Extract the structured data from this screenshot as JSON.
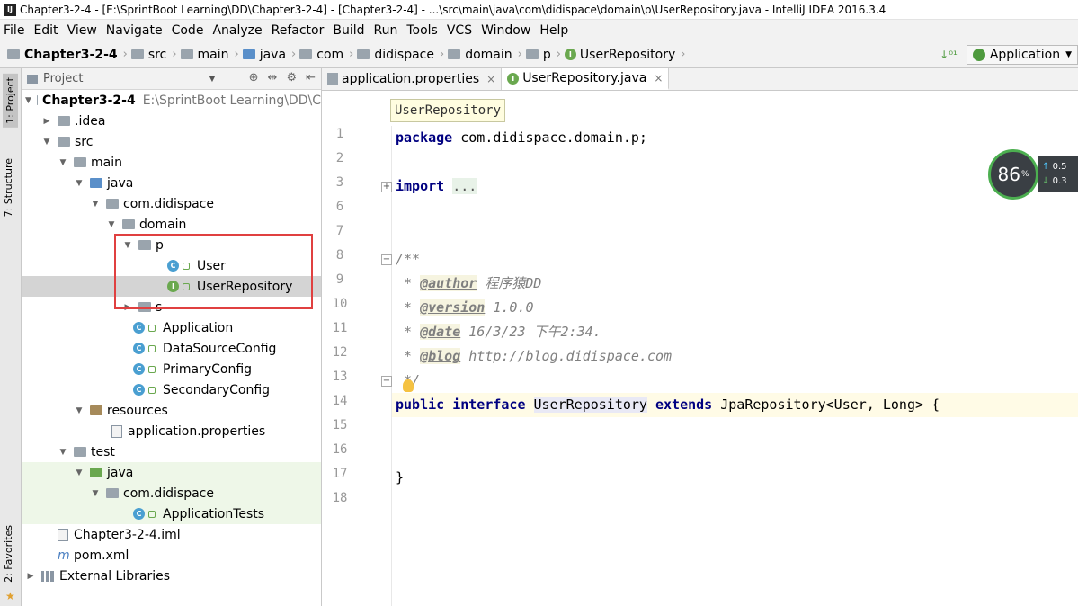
{
  "window": {
    "title": "Chapter3-2-4 - [E:\\SprintBoot Learning\\DD\\Chapter3-2-4] - [Chapter3-2-4] - ...\\src\\main\\java\\com\\didispace\\domain\\p\\UserRepository.java - IntelliJ IDEA 2016.3.4"
  },
  "menu": [
    "File",
    "Edit",
    "View",
    "Navigate",
    "Code",
    "Analyze",
    "Refactor",
    "Build",
    "Run",
    "Tools",
    "VCS",
    "Window",
    "Help"
  ],
  "breadcrumb": [
    "Chapter3-2-4",
    "src",
    "main",
    "java",
    "com",
    "didispace",
    "domain",
    "p",
    "UserRepository"
  ],
  "run_config": "Application",
  "side_tabs": {
    "project": "1: Project",
    "structure": "7: Structure",
    "favorites": "2: Favorites"
  },
  "project_panel": {
    "title": "Project"
  },
  "tree": [
    {
      "label": "Chapter3-2-4",
      "hint": "E:\\SprintBoot Learning\\DD\\C"
    },
    {
      "label": ".idea"
    },
    {
      "label": "src"
    },
    {
      "label": "main"
    },
    {
      "label": "java"
    },
    {
      "label": "com.didispace"
    },
    {
      "label": "domain"
    },
    {
      "label": "p"
    },
    {
      "label": "User"
    },
    {
      "label": "UserRepository"
    },
    {
      "label": "s"
    },
    {
      "label": "Application"
    },
    {
      "label": "DataSourceConfig"
    },
    {
      "label": "PrimaryConfig"
    },
    {
      "label": "SecondaryConfig"
    },
    {
      "label": "resources"
    },
    {
      "label": "application.properties"
    },
    {
      "label": "test"
    },
    {
      "label": "java"
    },
    {
      "label": "com.didispace"
    },
    {
      "label": "ApplicationTests"
    },
    {
      "label": "Chapter3-2-4.iml"
    },
    {
      "label": "pom.xml"
    },
    {
      "label": "External Libraries"
    }
  ],
  "editor": {
    "tabs": [
      {
        "label": "application.properties"
      },
      {
        "label": "UserRepository.java"
      }
    ],
    "tooltip": "UserRepository",
    "line_numbers": [
      "1",
      "2",
      "3",
      "6",
      "7",
      "8",
      "9",
      "10",
      "11",
      "12",
      "13",
      "14",
      "15",
      "16",
      "17",
      "18"
    ],
    "code": {
      "l1_kw": "package",
      "l1_rest": " com.didispace.domain.p;",
      "l3_kw": "import",
      "l3_fold": "...",
      "l8": "/**",
      "l9_star": " * ",
      "l9_tag": "@author",
      "l9_text": " 程序猿DD",
      "l10_star": " * ",
      "l10_tag": "@version",
      "l10_text": " 1.0.0",
      "l11_star": " * ",
      "l11_tag": "@date",
      "l11_text": " 16/3/23 下午2:34.",
      "l12_star": " * ",
      "l12_tag": "@blog",
      "l12_text": " http://blog.didispace.com",
      "l13": " */",
      "l14_kw1": "public",
      "l14_kw2": "interface",
      "l14_name": "UserRepository",
      "l14_kw3": "extends",
      "l14_rest": " JpaRepository<User, Long> {",
      "l17": "}"
    }
  },
  "monitor": {
    "percent": "86",
    "unit": "%",
    "up": "0.5",
    "down": "0.3"
  }
}
